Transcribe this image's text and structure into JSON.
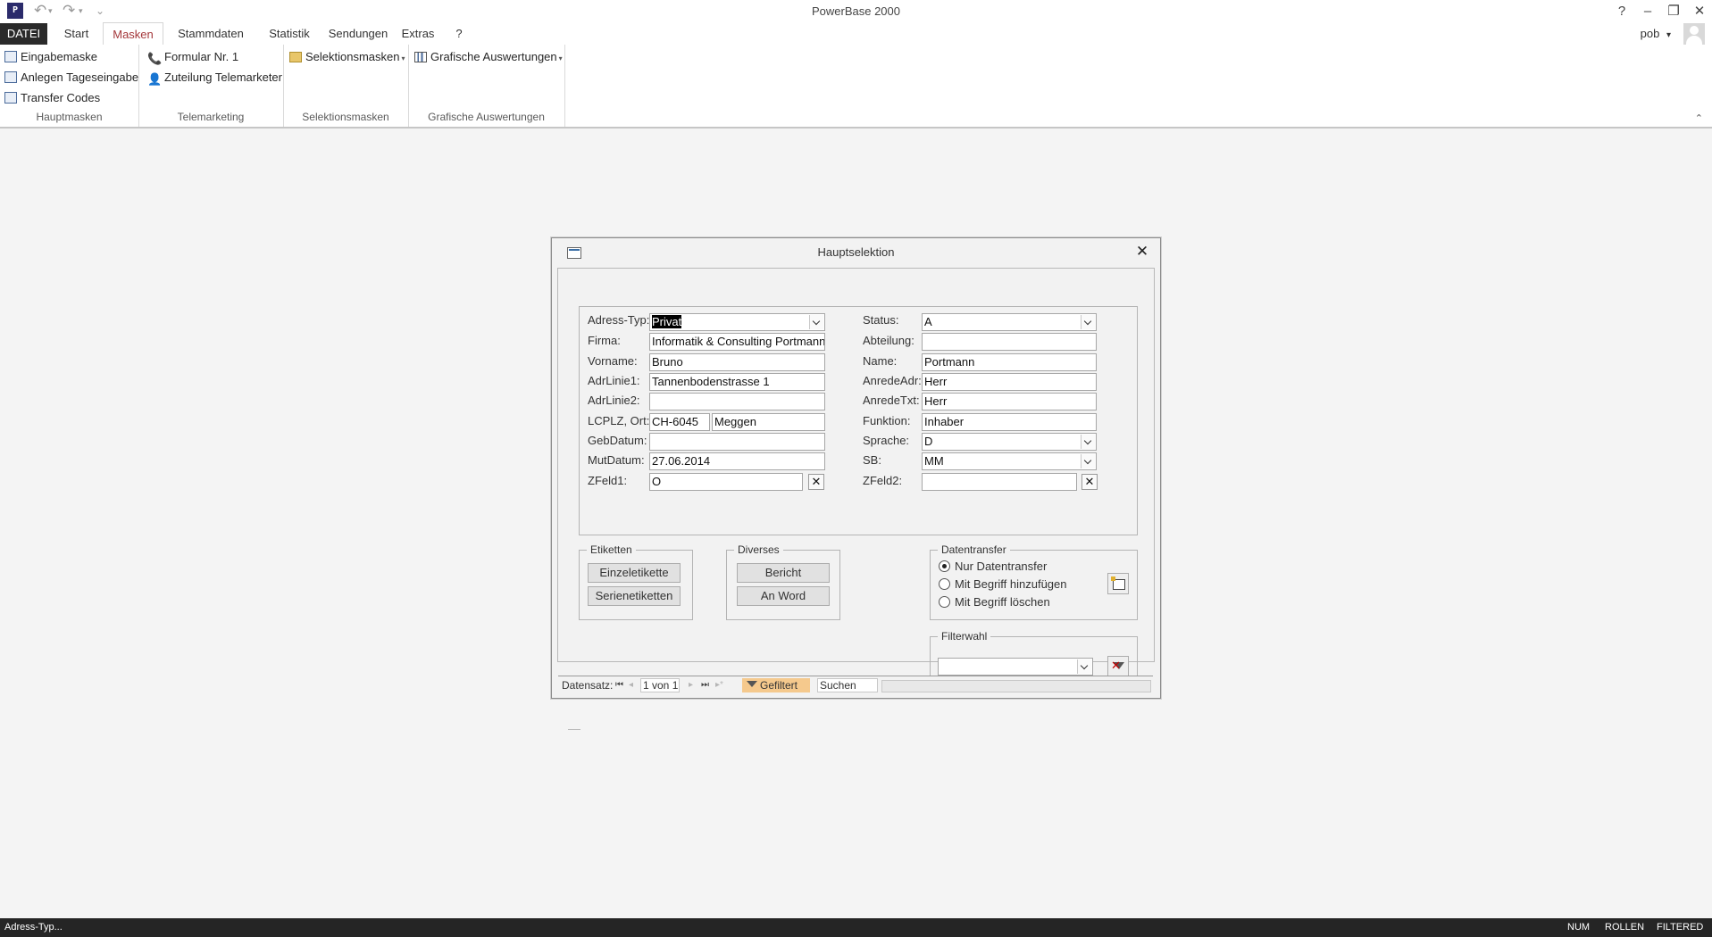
{
  "window": {
    "app_icon_text": "P",
    "title": "PowerBase 2000",
    "help": "?",
    "user": "pob",
    "user_menu_arrow": "▾",
    "qat_undo": "↶",
    "qat_redo": "↷",
    "qat_customize": "⌄"
  },
  "ribbon": {
    "tabs": [
      "DATEI",
      "Start",
      "Masken",
      "Stammdaten",
      "Statistik",
      "Sendungen",
      "Extras",
      "?"
    ],
    "active_tab": "Masken",
    "groups": {
      "hauptmasken": {
        "label": "Hauptmasken",
        "items": [
          "Eingabemaske",
          "Anlegen Tageseingabe",
          "Transfer Codes"
        ]
      },
      "telemarketing": {
        "label": "Telemarketing",
        "items": [
          "Formular Nr. 1",
          "Zuteilung Telemarketer"
        ]
      },
      "selektionsmasken": {
        "label": "Selektionsmasken",
        "button": "Selektionsmasken"
      },
      "grafische": {
        "label": "Grafische Auswertungen",
        "button": "Grafische Auswertungen"
      }
    }
  },
  "dialog": {
    "title": "Hauptselektion",
    "fields": {
      "adress_typ": {
        "label": "Adress-Typ:",
        "value": "Privat"
      },
      "firma": {
        "label": "Firma:",
        "value": "Informatik & Consulting Portmann"
      },
      "vorname": {
        "label": "Vorname:",
        "value": "Bruno"
      },
      "adrlinie1": {
        "label": "AdrLinie1:",
        "value": "Tannenbodenstrasse 1"
      },
      "adrlinie2": {
        "label": "AdrLinie2:",
        "value": ""
      },
      "lcplz_ort": {
        "label": "LCPLZ, Ort:",
        "plz": "CH-6045",
        "ort": "Meggen"
      },
      "gebdatum": {
        "label": "GebDatum:",
        "value": ""
      },
      "mutdatum": {
        "label": "MutDatum:",
        "value": "27.06.2014"
      },
      "zfeld1": {
        "label": "ZFeld1:",
        "value": "O"
      },
      "status": {
        "label": "Status:",
        "value": "A"
      },
      "abteilung": {
        "label": "Abteilung:",
        "value": ""
      },
      "name": {
        "label": "Name:",
        "value": "Portmann"
      },
      "anredeadr": {
        "label": "AnredeAdr:",
        "value": "Herr"
      },
      "anredetxt": {
        "label": "AnredeTxt:",
        "value": "Herr"
      },
      "funktion": {
        "label": "Funktion:",
        "value": "Inhaber"
      },
      "sprache": {
        "label": "Sprache:",
        "value": "D"
      },
      "sb": {
        "label": "SB:",
        "value": "MM"
      },
      "zfeld2": {
        "label": "ZFeld2:",
        "value": ""
      }
    },
    "clear_glyph": "✕",
    "etiketten": {
      "title": "Etiketten",
      "buttons": [
        "Einzeletikette",
        "Serienetiketten"
      ]
    },
    "diverses": {
      "title": "Diverses",
      "buttons": [
        "Bericht",
        "An Word"
      ]
    },
    "datentransfer": {
      "title": "Datentransfer",
      "options": [
        "Nur Datentransfer",
        "Mit Begriff hinzufügen",
        "Mit Begriff löschen"
      ],
      "selected_index": 0
    },
    "filterwahl": {
      "title": "Filterwahl",
      "value": ""
    },
    "navigation": {
      "label": "Datensatz:",
      "current": "1 von 1",
      "filter_status": "Gefiltert",
      "search": "Suchen",
      "first": "⏮",
      "prev": "◂",
      "next": "▸",
      "last": "⏭",
      "new": "▸*"
    }
  },
  "statusbar": {
    "left": "Adress-Typ...",
    "indicators": [
      "NUM",
      "ROLLEN",
      "FILTERED"
    ]
  }
}
